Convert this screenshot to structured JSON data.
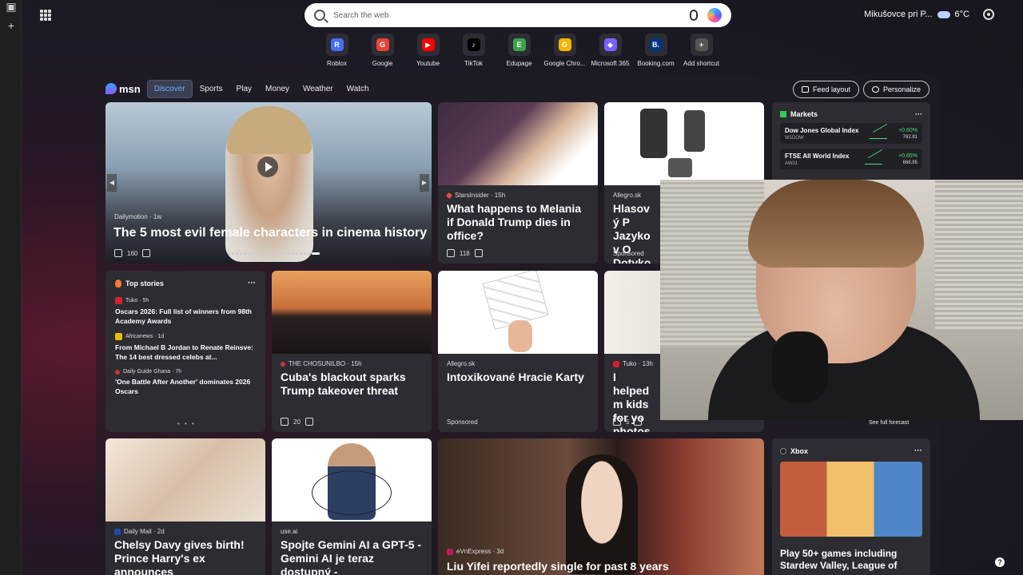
{
  "search": {
    "placeholder": "Search the web"
  },
  "weather": {
    "location": "Mikušovce pri P...",
    "temp": "6°C"
  },
  "shortcuts": [
    {
      "label": "Roblox",
      "icon": "roblox-icon",
      "color": "#4a6cf7"
    },
    {
      "label": "Google",
      "icon": "google-icon",
      "color": "#ea4335"
    },
    {
      "label": "Youtube",
      "icon": "youtube-icon",
      "color": "#ff0000"
    },
    {
      "label": "TikTok",
      "icon": "tiktok-icon",
      "color": "#000000"
    },
    {
      "label": "Edupage",
      "icon": "edupage-icon",
      "color": "#3fa34d"
    },
    {
      "label": "Google Chro...",
      "icon": "chrome-icon",
      "color": "#f4b400"
    },
    {
      "label": "Microsoft 365",
      "icon": "m365-icon",
      "color": "#7b61ff"
    },
    {
      "label": "Booking.com",
      "icon": "booking-icon",
      "color": "#003580"
    },
    {
      "label": "Add shortcut",
      "icon": "plus-icon",
      "color": "#555555"
    }
  ],
  "shortcut_glyphs": [
    "R",
    "G",
    "▶",
    "♪",
    "E",
    "G",
    "◆",
    "B.",
    "+"
  ],
  "feed": {
    "logo": "msn",
    "tabs": [
      "Discover",
      "Sports",
      "Play",
      "Money",
      "Weather",
      "Watch"
    ],
    "feed_layout": "Feed layout",
    "personalize": "Personalize"
  },
  "hero": {
    "source": "Dailymotion · 1w",
    "title": "The 5 most evil female characters in cinema history",
    "likes": "160"
  },
  "cards": {
    "melania": {
      "source": "StarsInsider · 15h",
      "title": "What happens to Melania if Donald Trump dies in office?",
      "likes": "118"
    },
    "allegro1": {
      "source": "Allegro.sk",
      "title": "Hlasový P Jazykov O Dotykový",
      "sponsored": "Sponsored"
    },
    "cuba": {
      "source": "THE CHOSUNILBO · 15h",
      "title": "Cuba's blackout sparks Trump takeover threat",
      "likes": "20"
    },
    "cards": {
      "source": "Allegro.sk",
      "title": "Intoxikované Hracie Karty",
      "sponsored": "Sponsored"
    },
    "tuko": {
      "source": "Tuko · 13h",
      "title": "I helped m kids for yo photos sh",
      "likes": "5"
    },
    "chelsy": {
      "source": "Daily Mail · 2d",
      "title": "Chelsy Davy gives birth! Prince Harry's ex announces"
    },
    "gemini": {
      "source": "use.ai",
      "title": "Spojte Gemini AI a GPT-5 - Gemini AI je teraz dostupný -"
    },
    "liu": {
      "source": "eVnExpress · 3d",
      "title": "Liu Yifei reportedly single for past 8 years"
    }
  },
  "markets": {
    "title": "Markets",
    "rows": [
      {
        "name": "Dow Jones Global Index",
        "code": "W1DOW",
        "change": "+0.60%",
        "value": "762.81"
      },
      {
        "name": "FTSE All World Index",
        "code": "AW01",
        "change": "+0.65%",
        "value": "668.95"
      }
    ]
  },
  "top_stories": {
    "title": "Top stories",
    "items": [
      {
        "source": "Tuko · 5h",
        "title": "Oscars 2026: Full list of winners from 98th Academy Awards",
        "color": "#d4202c"
      },
      {
        "source": "Africanews · 1d",
        "title": "From Michael B Jordan to Renate Reinsve: The 14 best dressed celebs at...",
        "color": "#e6c000"
      },
      {
        "source": "Daily Guide Ghana · 7h",
        "title": "'One Battle After Another' dominates 2026 Oscars",
        "color": "#c0392b"
      }
    ]
  },
  "forecast": "See full forecast",
  "xbox": {
    "title": "Xbox",
    "headline": "Play 50+ games including Stardew Valley, League of"
  }
}
